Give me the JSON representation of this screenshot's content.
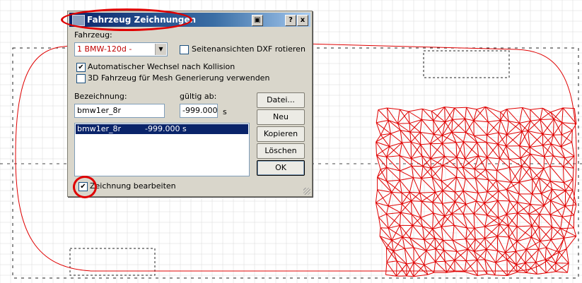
{
  "dialog": {
    "title": "Fahrzeug Zeichnungen",
    "vehicle_label": "Fahrzeug:",
    "vehicle_value": "1 BMW-120d -",
    "rotate_dxf_label": "Seitenansichten DXF rotieren",
    "rotate_dxf_checked": false,
    "auto_switch_label": "Automatischer Wechsel nach Kollision",
    "auto_switch_checked": true,
    "mesh_label": "3D Fahrzeug für Mesh Generierung verwenden",
    "mesh_checked": false,
    "name_label": "Bezeichnung:",
    "name_value": "bmw1er_8r",
    "valid_label": "gültig ab:",
    "valid_value": "-999.000",
    "valid_unit": "s",
    "list_items": [
      {
        "name": "bmw1er_8r",
        "time": "-999.000 s",
        "selected": true
      }
    ],
    "buttons": {
      "file": "Datei...",
      "new": "Neu",
      "copy": "Kopieren",
      "delete": "Löschen",
      "ok": "OK"
    },
    "edit_label": "Zeichnung bearbeiten",
    "edit_checked": true,
    "titlebar_buttons": {
      "help": "?",
      "close": "x"
    }
  },
  "colors": {
    "drawing": "#e00000",
    "annotation": "#e00000",
    "grid": "#d8d8d8",
    "selection": "#0a246a"
  }
}
